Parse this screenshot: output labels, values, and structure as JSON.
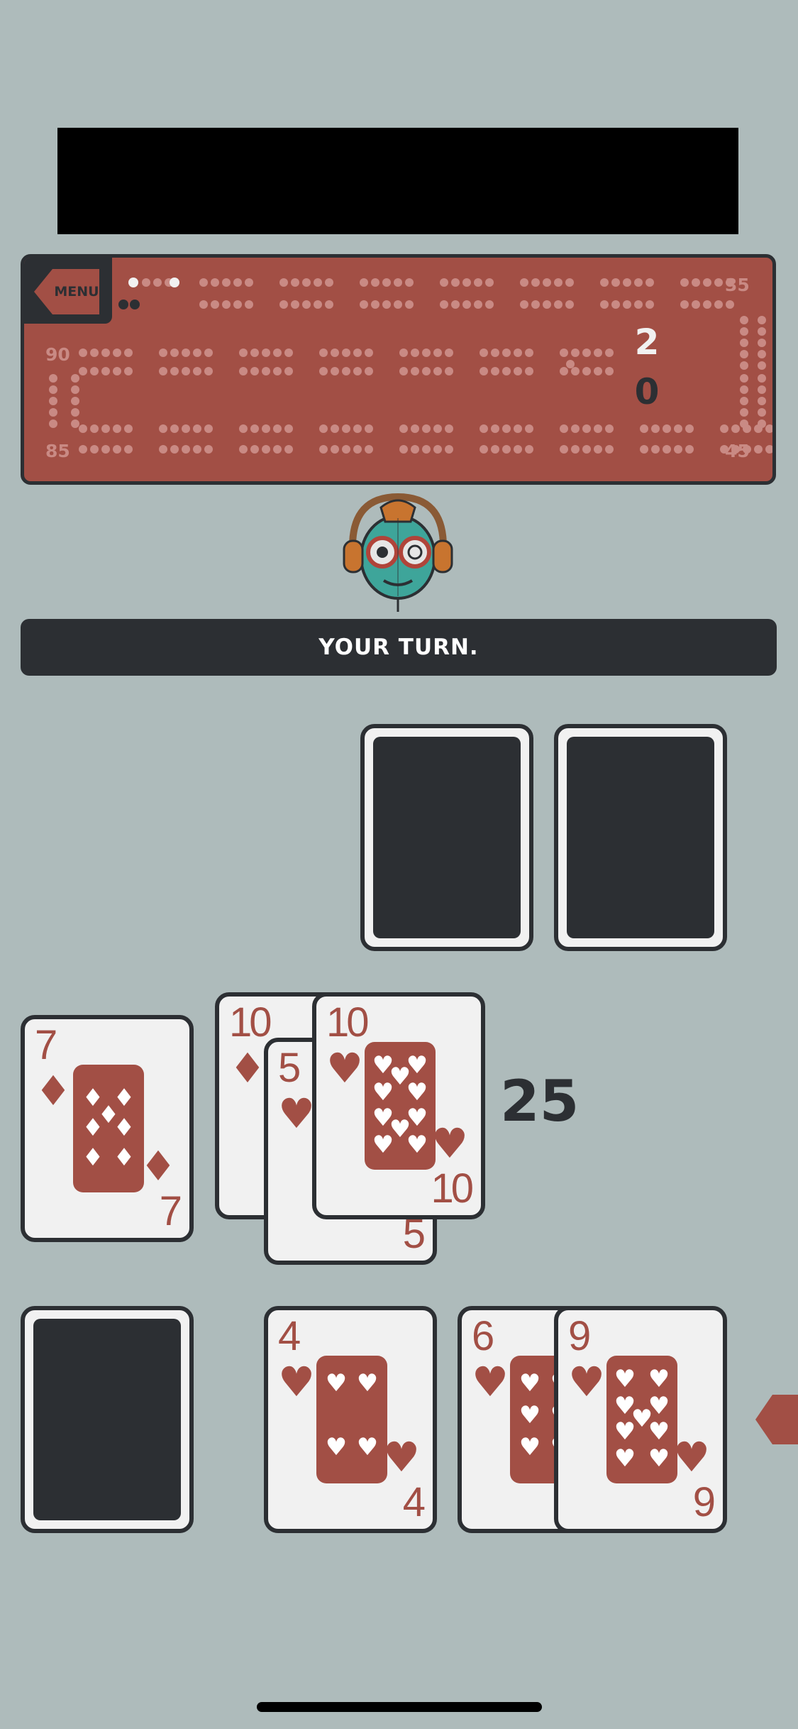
{
  "board": {
    "menu_label": "MENU",
    "numbers": [
      "35",
      "90",
      "85",
      "45"
    ],
    "scores": {
      "player_top": "2",
      "player_bottom": "0"
    },
    "colors": {
      "board": "#a24f45",
      "dark": "#2c2f33",
      "hole": "#c98a84"
    }
  },
  "status": {
    "message": "YOUR TURN."
  },
  "pegging": {
    "cards": [
      {
        "rank": "7",
        "suit": "♦"
      },
      {
        "rank": "10",
        "suit": "♦"
      },
      {
        "rank": "5",
        "suit": "♥"
      },
      {
        "rank": "10",
        "suit": "♥"
      }
    ],
    "count": "25"
  },
  "opponent_hand": {
    "cards": [
      "card-back",
      "card-back"
    ]
  },
  "player_hand": {
    "deck": "card-back",
    "cards": [
      {
        "rank": "4",
        "suit": "♥"
      },
      {
        "rank": "6",
        "suit": "♥"
      },
      {
        "rank": "9",
        "suit": "♥"
      }
    ]
  },
  "avatar": {
    "icon": "robot-avatar-icon"
  }
}
